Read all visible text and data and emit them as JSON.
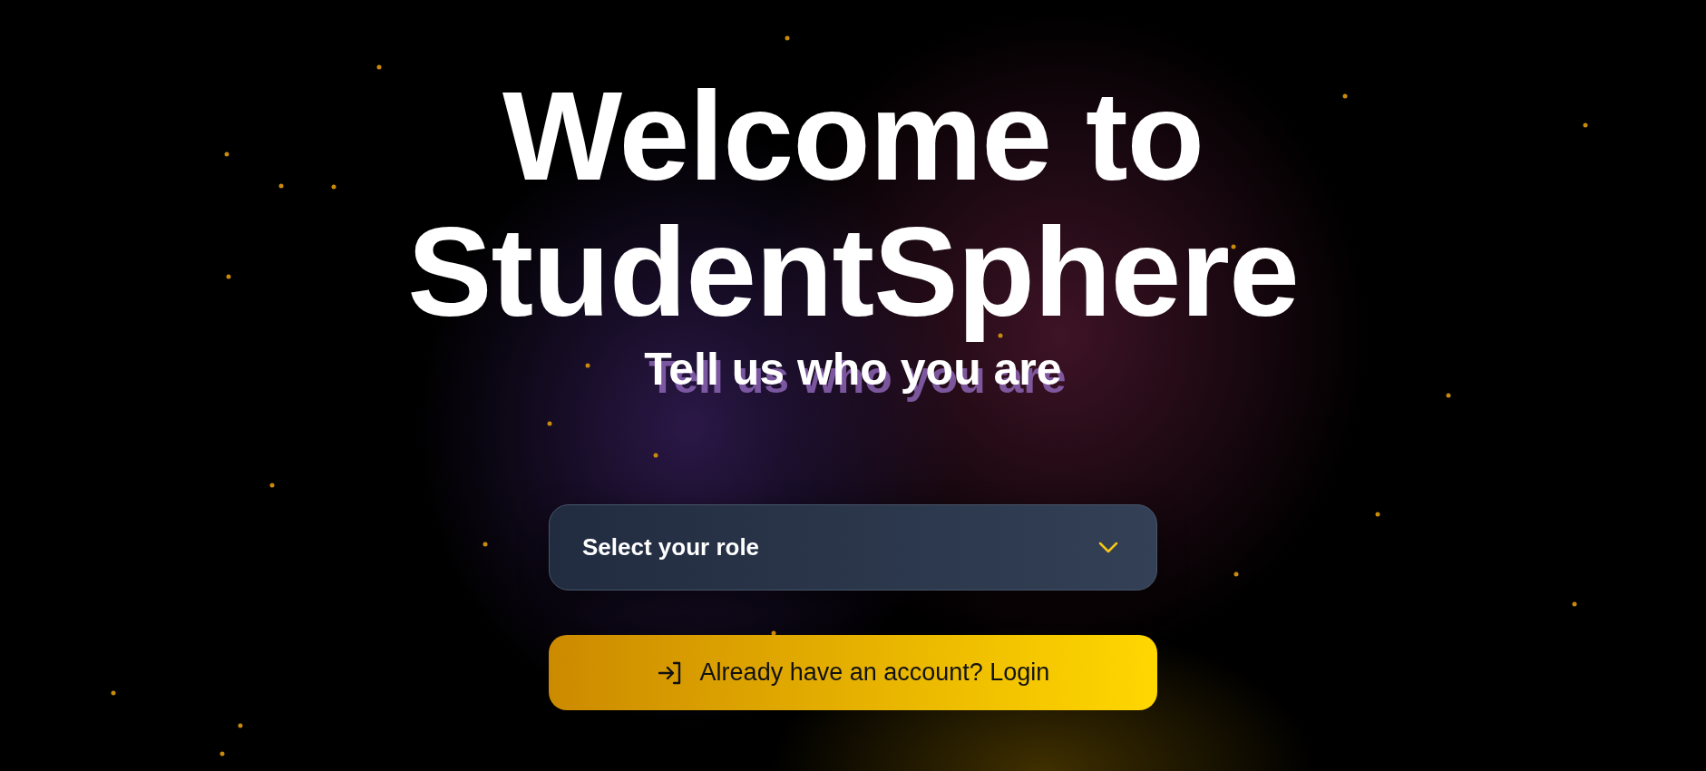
{
  "heading": {
    "title": "Welcome to StudentSphere",
    "subtitle": "Tell us who you are"
  },
  "role_select": {
    "placeholder": "Select your role"
  },
  "login_button": {
    "label": "Already have an account? Login"
  }
}
